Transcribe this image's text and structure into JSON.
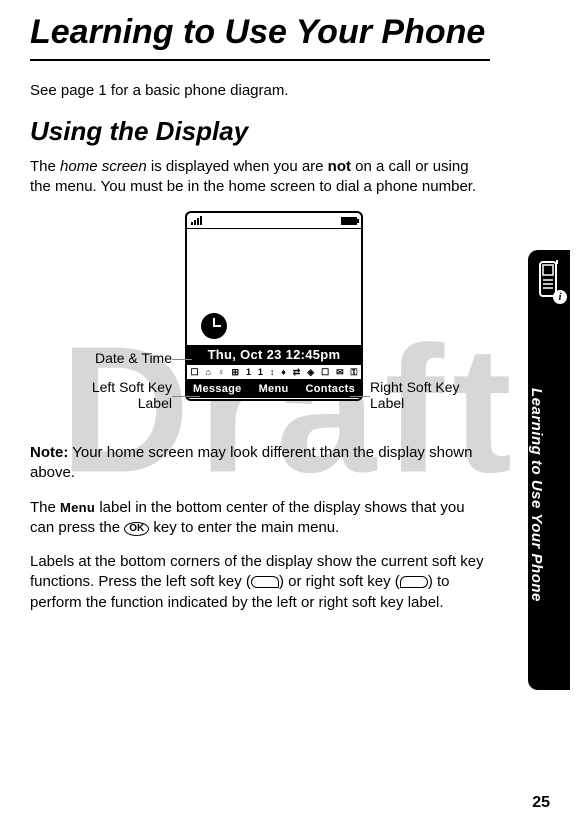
{
  "watermark": "Draft",
  "title": "Learning to Use Your Phone",
  "intro": "See page 1 for a basic phone diagram.",
  "section1_heading": "Using the Display",
  "section1_p1_a": "The ",
  "section1_p1_em": "home screen",
  "section1_p1_b": " is displayed when you are ",
  "section1_p1_bold": "not",
  "section1_p1_c": " on a call or using the menu. You must be in the home screen to dial a phone number.",
  "diagram": {
    "datetime": "Thu, Oct 23 12:45pm",
    "iconrow": [
      "☐",
      "⌂",
      "♀",
      "⊞",
      "1",
      "1",
      "↕",
      "♦",
      "⇄",
      "◈",
      "☐",
      "✉",
      "⚿"
    ],
    "softkeys": {
      "left": "Message",
      "center": "Menu",
      "right": "Contacts"
    },
    "callouts": {
      "datetime": "Date & Time",
      "leftsoft_line1": "Left Soft Key",
      "leftsoft_line2": "Label",
      "rightsoft_line1": "Right Soft Key",
      "rightsoft_line2": "Label"
    }
  },
  "note_label": "Note:",
  "note_text": " Your home screen may look different than the display shown above.",
  "p3_a": "The ",
  "p3_menu": "Menu",
  "p3_b": " label in the bottom center of the display shows that you can press the ",
  "p3_ok": "OK",
  "p3_c": " key to enter the main menu.",
  "p4_a": "Labels at the bottom corners of the display show the current soft key functions. Press the left soft key (",
  "p4_b": ") or right soft key (",
  "p4_c": ") to perform the function indicated by the left or right soft key label.",
  "sidetab_text": "Learning to Use Your Phone",
  "info_badge": "i",
  "page_number": "25"
}
